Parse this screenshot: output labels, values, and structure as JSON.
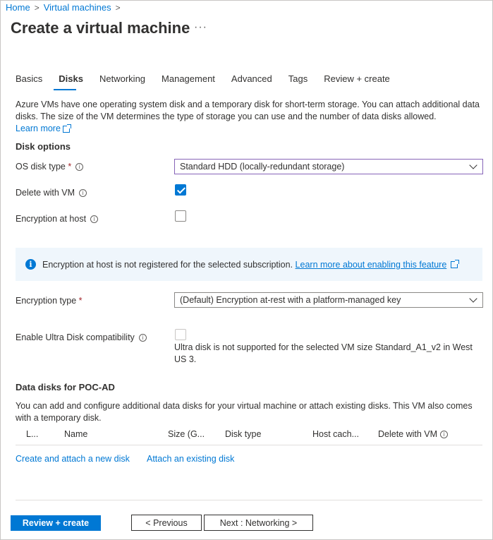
{
  "breadcrumb": {
    "home": "Home",
    "sep": ">",
    "vms": "Virtual machines"
  },
  "page": {
    "title": "Create a virtual machine",
    "more": "···"
  },
  "tabs": [
    {
      "label": "Basics"
    },
    {
      "label": "Disks"
    },
    {
      "label": "Networking"
    },
    {
      "label": "Management"
    },
    {
      "label": "Advanced"
    },
    {
      "label": "Tags"
    },
    {
      "label": "Review + create"
    }
  ],
  "intro": {
    "text": "Azure VMs have one operating system disk and a temporary disk for short-term storage. You can attach additional data disks. The size of the VM determines the type of storage you can use and the number of data disks allowed.",
    "learn_more": "Learn more"
  },
  "disk_options": {
    "title": "Disk options",
    "os_disk_type": {
      "label": "OS disk type",
      "required": "*",
      "value": "Standard HDD (locally-redundant storage)"
    },
    "delete_with_vm": {
      "label": "Delete with VM",
      "checked": true
    },
    "encryption_at_host": {
      "label": "Encryption at host",
      "checked": false
    }
  },
  "info_bar": {
    "icon": "i",
    "text": "Encryption at host is not registered for the selected subscription.",
    "link": "Learn more about enabling this feature"
  },
  "encryption_type": {
    "label": "Encryption type",
    "required": "*",
    "value": "(Default) Encryption at-rest with a platform-managed key"
  },
  "ultra_disk": {
    "label": "Enable Ultra Disk compatibility",
    "note": "Ultra disk is not supported for the selected VM size Standard_A1_v2 in West US 3."
  },
  "data_disks": {
    "title": "Data disks for POC-AD",
    "desc": "You can add and configure additional data disks for your virtual machine or attach existing disks. This VM also comes with a temporary disk.",
    "columns": [
      "L...",
      "Name",
      "Size (G...",
      "Disk type",
      "Host cach...",
      "Delete with VM"
    ],
    "create_link": "Create and attach a new disk",
    "attach_link": "Attach an existing disk"
  },
  "footer": {
    "review_create": "Review + create",
    "previous": "< Previous",
    "next": "Next : Networking >"
  },
  "colors": {
    "accent": "#0078d4",
    "required": "#a4262c",
    "info_bg": "#eff6fc"
  }
}
